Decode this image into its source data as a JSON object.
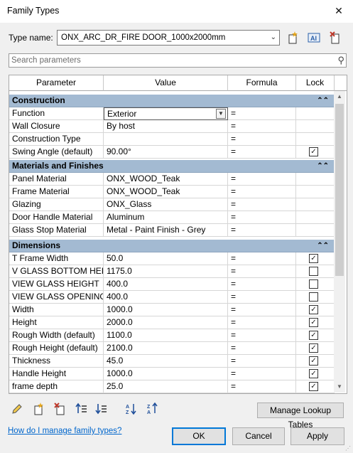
{
  "window": {
    "title": "Family Types",
    "close_glyph": "✕"
  },
  "type": {
    "label": "Type name:",
    "value": "ONX_ARC_DR_FIRE DOOR_1000x2000mm"
  },
  "search": {
    "placeholder": "Search parameters"
  },
  "columns": {
    "parameter": "Parameter",
    "value": "Value",
    "formula": "Formula",
    "lock": "Lock"
  },
  "groups": [
    {
      "name": "Construction",
      "rows": [
        {
          "param": "Function",
          "value": "Exterior",
          "formula": "=",
          "lock": null,
          "dropdown": true
        },
        {
          "param": "Wall Closure",
          "value": "By host",
          "formula": "=",
          "lock": null
        },
        {
          "param": "Construction Type",
          "value": "",
          "formula": "=",
          "lock": null
        },
        {
          "param": "Swing Angle (default)",
          "value": "90.00°",
          "formula": "=",
          "lock": true
        }
      ]
    },
    {
      "name": "Materials and Finishes",
      "rows": [
        {
          "param": "Panel Material",
          "value": "ONX_WOOD_Teak",
          "formula": "=",
          "lock": null
        },
        {
          "param": "Frame Material",
          "value": "ONX_WOOD_Teak",
          "formula": "=",
          "lock": null
        },
        {
          "param": "Glazing",
          "value": "ONX_Glass",
          "formula": "=",
          "lock": null
        },
        {
          "param": "Door Handle Material",
          "value": "Aluminum",
          "formula": "=",
          "lock": null
        },
        {
          "param": "Glass Stop Material",
          "value": "Metal - Paint Finish - Grey",
          "formula": "=",
          "lock": null
        }
      ]
    },
    {
      "name": "Dimensions",
      "rows": [
        {
          "param": "T Frame Width",
          "value": "50.0",
          "formula": "=",
          "lock": true
        },
        {
          "param": "V GLASS BOTTOM HEIG",
          "value": "1175.0",
          "formula": "=",
          "lock": false
        },
        {
          "param": "VIEW GLASS HEIGHT",
          "value": "400.0",
          "formula": "=",
          "lock": false
        },
        {
          "param": "VIEW GLASS OPENING",
          "value": "400.0",
          "formula": "=",
          "lock": false
        },
        {
          "param": "Width",
          "value": "1000.0",
          "formula": "=",
          "lock": true
        },
        {
          "param": "Height",
          "value": "2000.0",
          "formula": "=",
          "lock": true
        },
        {
          "param": "Rough Width (default)",
          "value": "1100.0",
          "formula": "=",
          "lock": true
        },
        {
          "param": "Rough Height (default)",
          "value": "2100.0",
          "formula": "=",
          "lock": true
        },
        {
          "param": "Thickness",
          "value": "45.0",
          "formula": "=",
          "lock": true
        },
        {
          "param": "Handle Height",
          "value": "1000.0",
          "formula": "=",
          "lock": true
        },
        {
          "param": "frame depth",
          "value": "25.0",
          "formula": "=",
          "lock": true
        }
      ]
    }
  ],
  "buttons": {
    "lookup": "Manage Lookup Tables",
    "ok": "OK",
    "cancel": "Cancel",
    "apply": "Apply"
  },
  "help_link": "How do I manage family types?",
  "colors": {
    "group_header": "#a3bad2",
    "link": "#0066cc",
    "ok_border": "#0078d7"
  }
}
